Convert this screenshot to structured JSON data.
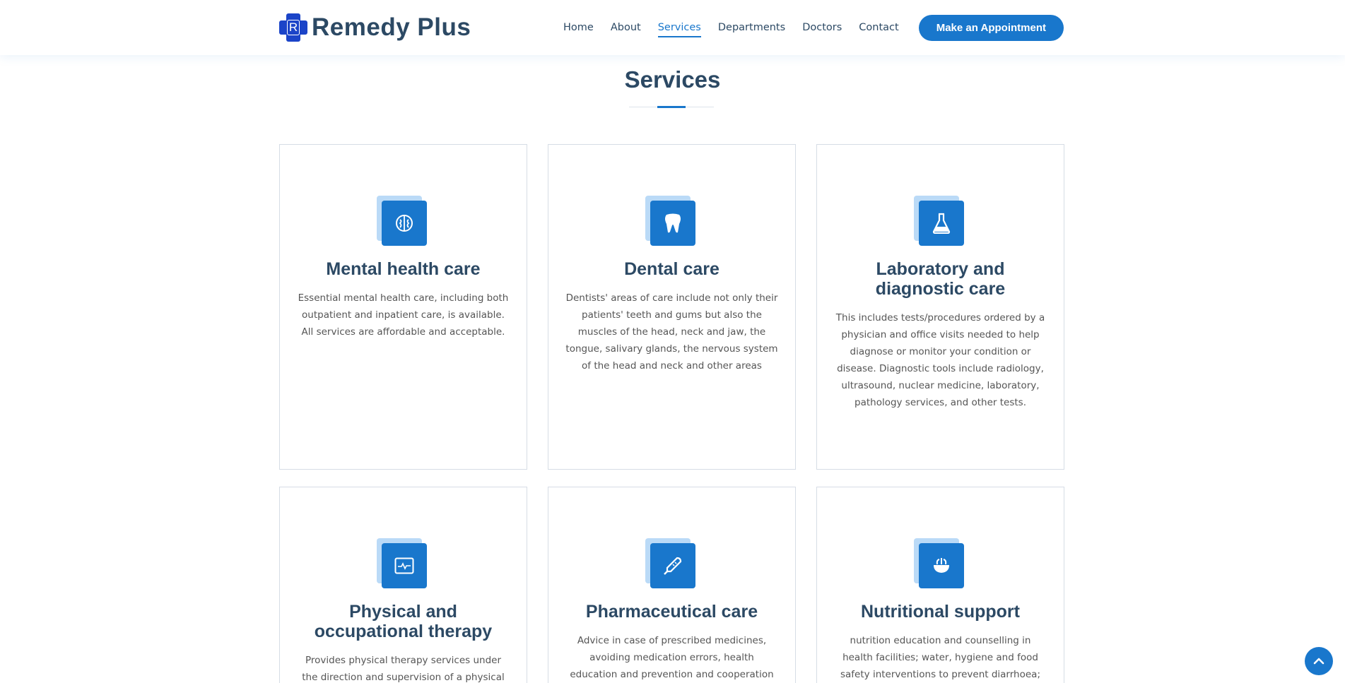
{
  "brand": {
    "name": "Remedy Plus",
    "logo_letter": "R"
  },
  "nav": {
    "items": [
      "Home",
      "About",
      "Services",
      "Departments",
      "Doctors",
      "Contact"
    ],
    "active": "Services",
    "cta_label": "Make an Appointment"
  },
  "section": {
    "title": "Services"
  },
  "services": [
    {
      "icon": "brain-icon",
      "title": "Mental health care",
      "description": "Essential mental health care, including both outpatient and inpatient care, is available. All services are affordable and acceptable."
    },
    {
      "icon": "tooth-icon",
      "title": "Dental care",
      "description": "Dentists' areas of care include not only their patients' teeth and gums but also the muscles of the head, neck and jaw, the tongue, salivary glands, the nervous system of the head and neck and other areas"
    },
    {
      "icon": "flask-icon",
      "title": "Laboratory and diagnostic care",
      "description": "This includes tests/procedures ordered by a physician and office visits needed to help diagnose or monitor your condition or disease. Diagnostic tools include radiology, ultrasound, nuclear medicine, laboratory, pathology services, and other tests."
    },
    {
      "icon": "monitor-pulse-icon",
      "title": "Physical and occupational therapy",
      "description": "Provides physical therapy services under the direction and supervision of a physical"
    },
    {
      "icon": "thermometer-icon",
      "title": "Pharmaceutical care",
      "description": "Advice in case of prescribed medicines, avoiding medication errors, health education and prevention and cooperation with the"
    },
    {
      "icon": "food-bowl-icon",
      "title": "Nutritional support",
      "description": "nutrition education and counselling in health facilities; water, hygiene and food safety interventions to prevent diarrhoea; adequate"
    }
  ],
  "colors": {
    "primary": "#1977cc",
    "heading": "#2c4964",
    "icon_back": "#badaf7",
    "logo": "#1b44c8"
  }
}
